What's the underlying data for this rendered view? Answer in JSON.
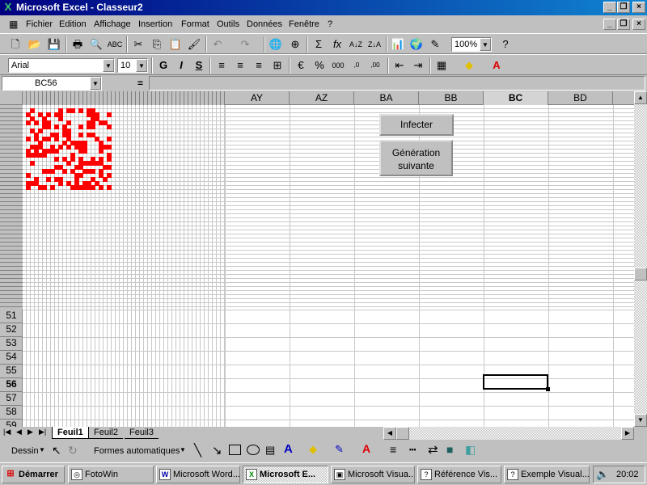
{
  "window": {
    "title": "Microsoft Excel - Classeur2"
  },
  "menu": [
    "Fichier",
    "Edition",
    "Affichage",
    "Insertion",
    "Format",
    "Outils",
    "Données",
    "Fenêtre",
    "?"
  ],
  "toolbar": {
    "zoom": "100%"
  },
  "format_bar": {
    "font": "Arial",
    "size": "10",
    "bold": "G",
    "italic": "I",
    "underline": "S"
  },
  "formula_bar": {
    "name_box": "BC56",
    "equals": "="
  },
  "columns": [
    "AY",
    "AZ",
    "BA",
    "BB",
    "BC",
    "BD"
  ],
  "selected_column": "BC",
  "rows": [
    "51",
    "52",
    "53",
    "54",
    "55",
    "56",
    "57",
    "58",
    "59"
  ],
  "selected_row": "56",
  "buttons": {
    "infect": "Infecter",
    "next_gen_line1": "Génération",
    "next_gen_line2": "suivante"
  },
  "sheets": [
    "Feuil1",
    "Feuil2",
    "Feuil3"
  ],
  "active_sheet": "Feuil1",
  "drawing": {
    "draw": "Dessin",
    "autoshapes": "Formes automatiques"
  },
  "taskbar": {
    "start": "Démarrer",
    "tasks": [
      "FotoWin",
      "Microsoft Word...",
      "Microsoft E...",
      "Microsoft Visua...",
      "Référence Vis...",
      "Exemple Visual..."
    ],
    "active_task": "Microsoft E...",
    "clock": "20:02"
  },
  "colors": {
    "titlebar": "#000080",
    "cells_infected": "#ff0000"
  }
}
